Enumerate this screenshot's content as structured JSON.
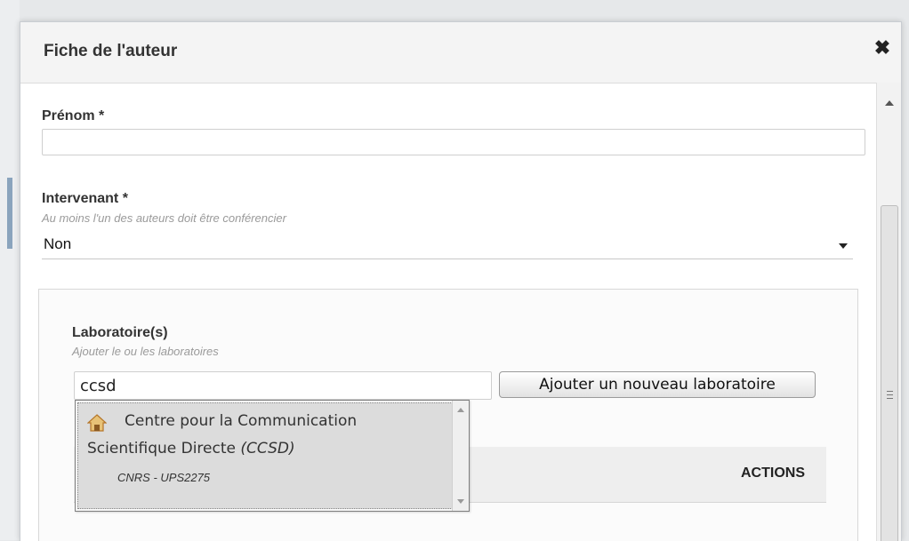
{
  "modal": {
    "title": "Fiche de l'auteur",
    "close_glyph": "✖"
  },
  "prenom": {
    "label": "Prénom *",
    "value": ""
  },
  "intervenant": {
    "label": "Intervenant *",
    "hint": "Au moins l'un des auteurs doit être conférencier",
    "selected": "Non"
  },
  "laboratoires": {
    "label": "Laboratoire(s)",
    "hint": "Ajouter le ou les laboratoires",
    "search_value": "ccsd",
    "add_button_label": "Ajouter un nouveau laboratoire",
    "actions_header": "ACTIONS",
    "suggestions": [
      {
        "name_line1": "Centre pour la Communication",
        "name_line2": "Scientifique Directe",
        "acronym": "(CCSD)",
        "subtitle": "CNRS - UPS2275",
        "icon": "house-icon"
      }
    ]
  },
  "colors": {
    "accent_icon": "#d98a2b",
    "header_bg": "#f4f4f4"
  }
}
